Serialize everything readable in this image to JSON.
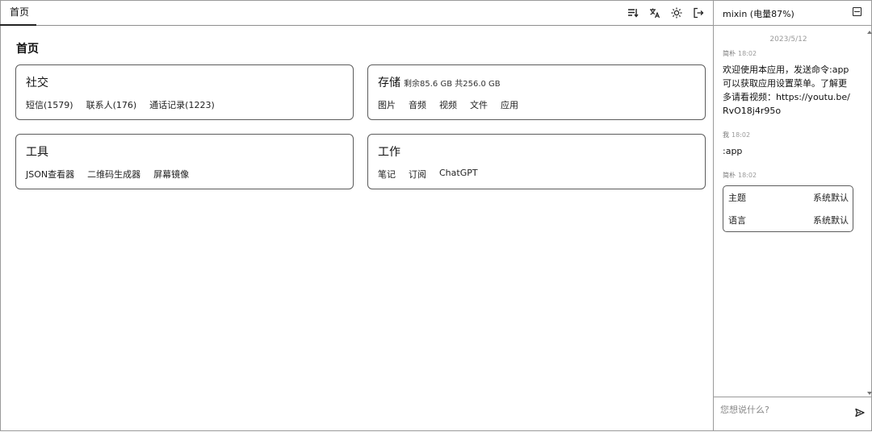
{
  "tabs": [
    {
      "label": "首页"
    }
  ],
  "toolbar": {
    "icons": [
      "sort-icon",
      "translate-icon",
      "theme-icon",
      "logout-icon"
    ]
  },
  "page": {
    "title": "首页"
  },
  "cards": {
    "social": {
      "title": "社交",
      "links": [
        "短信(1579)",
        "联系人(176)",
        "通话记录(1223)"
      ]
    },
    "storage": {
      "title": "存储",
      "subtitle": "剩余85.6 GB 共256.0 GB",
      "links": [
        "图片",
        "音频",
        "视频",
        "文件",
        "应用"
      ]
    },
    "tools": {
      "title": "工具",
      "links": [
        "JSON查看器",
        "二维码生成器",
        "屏幕镜像"
      ]
    },
    "work": {
      "title": "工作",
      "links": [
        "笔记",
        "订阅",
        "ChatGPT"
      ]
    }
  },
  "chat": {
    "title": "mixin (电量87%)",
    "date": "2023/5/12",
    "messages": [
      {
        "sender": "简朴",
        "time": "18:02",
        "text": "欢迎使用本应用，发送命令:app可以获取应用设置菜单。了解更多请看视频：https://youtu.be/RvO18j4r95o"
      },
      {
        "sender": "我",
        "time": "18:02",
        "text": ":app"
      },
      {
        "sender": "简朴",
        "time": "18:02"
      }
    ],
    "settings": [
      {
        "label": "主题",
        "value": "系统默认"
      },
      {
        "label": "语言",
        "value": "系统默认"
      }
    ],
    "input_placeholder": "您想说什么?"
  }
}
